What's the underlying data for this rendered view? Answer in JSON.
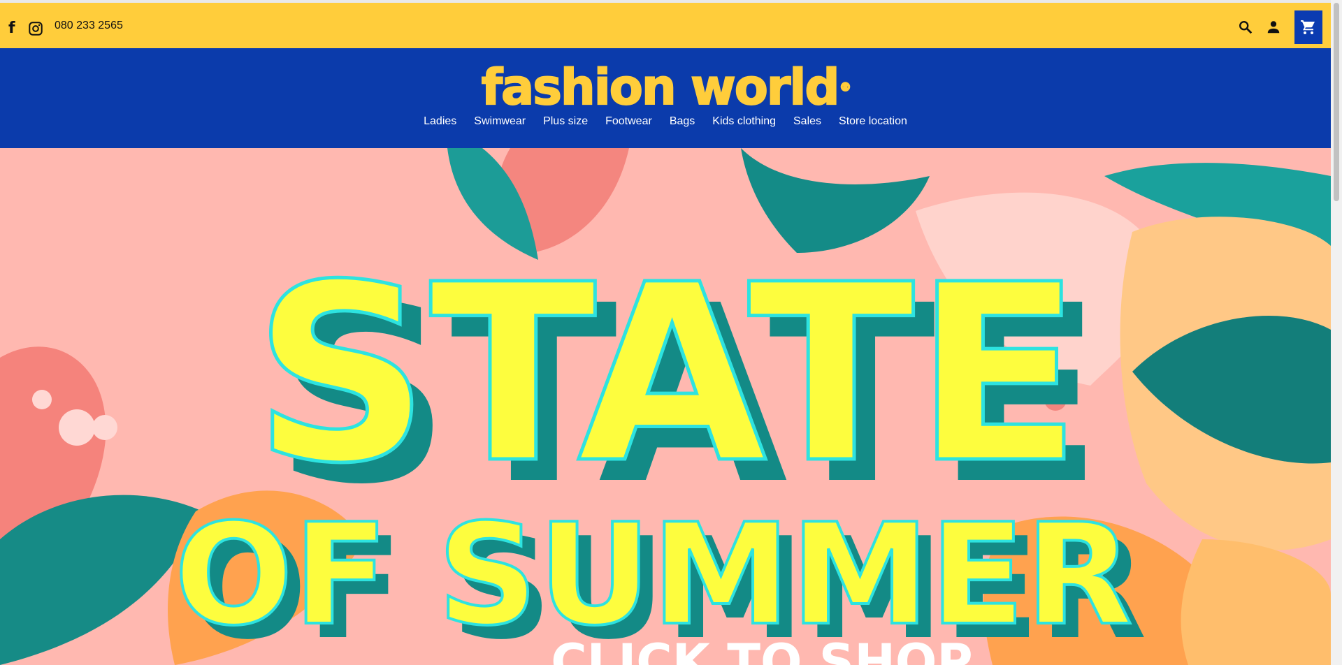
{
  "topbar": {
    "phone": "080 233 2565",
    "social": [
      "facebook-icon",
      "instagram-icon"
    ],
    "icons": [
      "search-icon",
      "user-icon",
      "cart-icon"
    ]
  },
  "header": {
    "logo_text": "fashion world",
    "logo_mark": "®",
    "nav": [
      "Ladies",
      "Swimwear",
      "Plus size",
      "Footwear",
      "Bags",
      "Kids clothing",
      "Sales",
      "Store location"
    ]
  },
  "hero": {
    "line1": "STATE",
    "line2": "OF SUMMER",
    "cta": "CLICK TO SHOP"
  },
  "colors": {
    "topbar": "#ffcd3b",
    "header": "#0b3bab",
    "hero_bg": "#ffb8b0",
    "hero_text": "#fdfd3e",
    "hero_shadow": "#138a86",
    "hero_outline": "#2de3e0"
  }
}
